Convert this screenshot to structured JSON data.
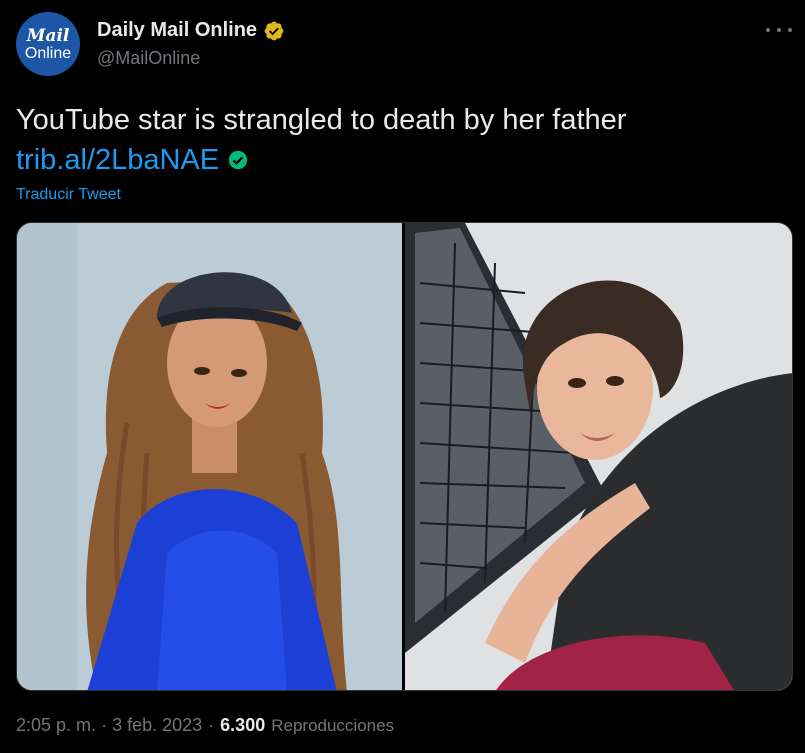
{
  "author": {
    "display_name": "Daily Mail Online",
    "handle": "@MailOnline",
    "avatar_text_top": "Mail",
    "avatar_text_bottom": "Online",
    "verified_badge": "gold-verified-icon"
  },
  "tweet": {
    "text": "YouTube star is strangled to death by her father",
    "link_text": "trib.al/2LbaNAE",
    "link_badge": "green-verified-icon",
    "translate_label": "Traducir Tweet",
    "media_count": 2
  },
  "meta": {
    "time": "2:05 p. m.",
    "separator": "·",
    "date": "3 feb. 2023",
    "views_count": "6.300",
    "views_label": "Reproducciones"
  },
  "colors": {
    "background": "#000000",
    "text": "#e7e9ea",
    "muted": "#71767b",
    "link": "#1d9bf0",
    "avatar_bg": "#1d56a6",
    "gold_badge": "#e2b719",
    "green_badge": "#00ba7c"
  }
}
